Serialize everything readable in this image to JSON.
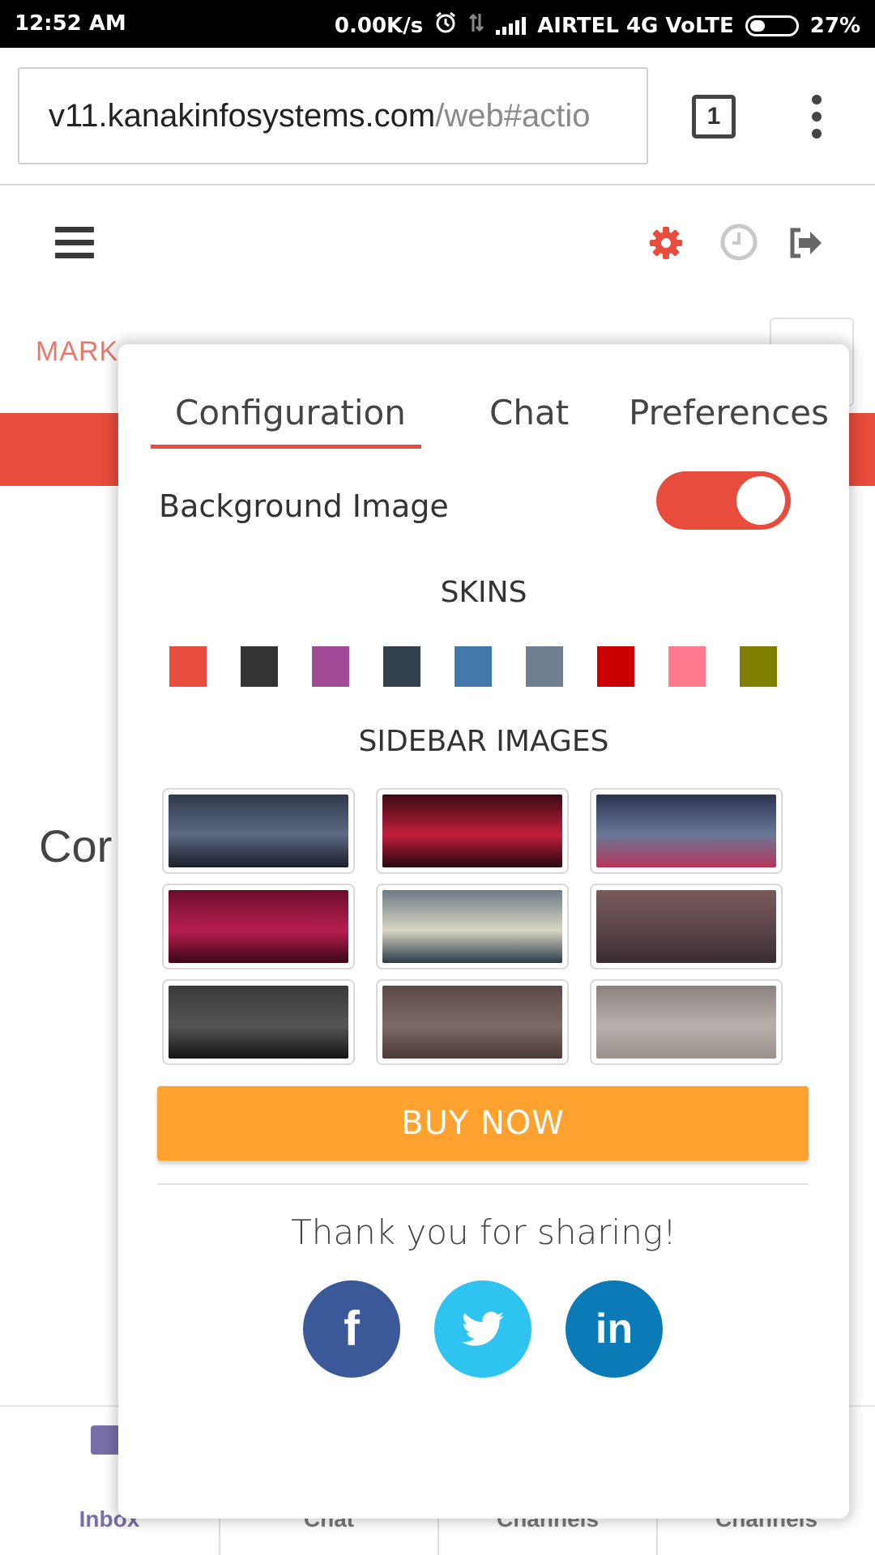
{
  "status_bar": {
    "time": "12:52 AM",
    "speed": "0.00K/s",
    "carrier": "AIRTEL 4G VoLTE",
    "battery": "27%"
  },
  "browser": {
    "url_host": "v11.kanakinfosystems.com",
    "url_path": "/web#actio",
    "tab_count": "1"
  },
  "background": {
    "mark_text": "MARK",
    "con_text": "Cor",
    "bottom_nav": [
      "Inbox",
      "Chat",
      "Channels",
      "Channels"
    ]
  },
  "panel": {
    "tabs": [
      {
        "label": "Configuration",
        "active": true
      },
      {
        "label": "Chat",
        "active": false
      },
      {
        "label": "Preferences",
        "active": false
      }
    ],
    "background_image_label": "Background Image",
    "background_image_enabled": true,
    "skins_title": "SKINS",
    "skins": [
      "#e74c3c",
      "#333333",
      "#a24a96",
      "#34424f",
      "#4378ab",
      "#6f7e91",
      "#cc0000",
      "#ff7a8d",
      "#7f7f00"
    ],
    "sidebar_images_title": "SIDEBAR IMAGES",
    "sidebar_images": [
      {
        "name": "night-road",
        "colors": [
          "#2f3a4d",
          "#5d6a82",
          "#1a1f2a"
        ]
      },
      {
        "name": "red-sky",
        "colors": [
          "#3a0a14",
          "#c21f3a",
          "#250710"
        ]
      },
      {
        "name": "mountains-night",
        "colors": [
          "#2a3350",
          "#6a7898",
          "#b8345a"
        ]
      },
      {
        "name": "magenta-hills",
        "colors": [
          "#6b0d2a",
          "#b81e52",
          "#3a0716"
        ]
      },
      {
        "name": "cloudy-sky",
        "colors": [
          "#6d7a86",
          "#d9d6c4",
          "#2c3a48"
        ]
      },
      {
        "name": "city-skyline",
        "colors": [
          "#7a5a5c",
          "#5a4448",
          "#3a2c30"
        ]
      },
      {
        "name": "dark-mountains",
        "colors": [
          "#3a3a3c",
          "#555557",
          "#141416"
        ]
      },
      {
        "name": "brown-gradient",
        "colors": [
          "#5a4a46",
          "#7e6a66",
          "#4a3a38"
        ]
      },
      {
        "name": "grey-haze",
        "colors": [
          "#8c8280",
          "#b8b0ac",
          "#9a908c"
        ]
      }
    ],
    "buy_label": "BUY NOW",
    "thanks": "Thank you for sharing!",
    "social": {
      "facebook": "f",
      "linkedin": "in"
    }
  }
}
